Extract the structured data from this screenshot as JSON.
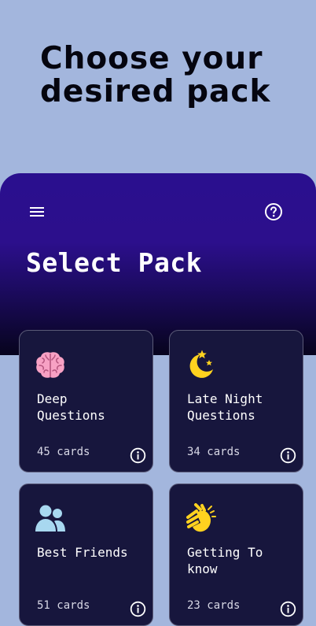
{
  "header": {
    "title": "Choose your desired pack"
  },
  "panel": {
    "title": "Select Pack",
    "menu_icon": "hamburger-menu-icon",
    "help_icon": "question-circle-icon"
  },
  "packs": [
    {
      "name": "Deep Questions",
      "count": "45 cards",
      "icon": "brain-icon",
      "icon_color": "#f7a1c4"
    },
    {
      "name": "Late Night Questions",
      "count": "34 cards",
      "icon": "moon-stars-icon",
      "icon_color": "#ffd21f"
    },
    {
      "name": "Best Friends",
      "count": "51 cards",
      "icon": "user-group-icon",
      "icon_color": "#a8d8f0"
    },
    {
      "name": "Getting To know",
      "count": "23 cards",
      "icon": "waving-hands-icon",
      "icon_color": "#ffd21f"
    }
  ],
  "colors": {
    "background": "#a3b6dd",
    "panel_top": "#2a0f8e",
    "card_background": "#17163d"
  }
}
